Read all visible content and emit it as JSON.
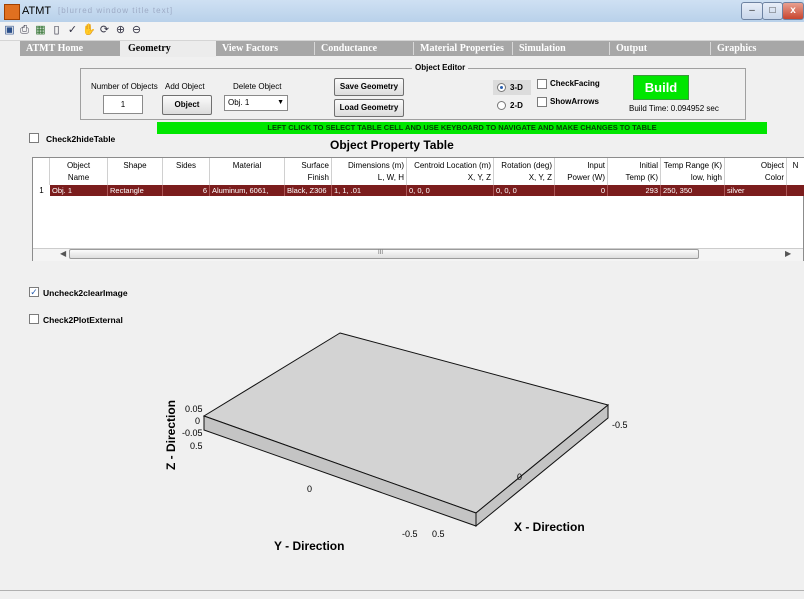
{
  "window": {
    "title": "ATMT",
    "title_extra": "[blurred window title text]"
  },
  "toolbar": {
    "icons": [
      "save-icon",
      "print-icon",
      "table-icon",
      "page-icon",
      "data-cursor-icon",
      "pan-icon",
      "rotate-icon",
      "zoom-in-icon",
      "zoom-out-icon"
    ]
  },
  "tabs": [
    "ATMT Home",
    "Geometry",
    "View Factors",
    "Conductance",
    "Material Properties",
    "Simulation",
    "Output",
    "Graphics"
  ],
  "active_tab": "Geometry",
  "editor": {
    "legend": "Object Editor",
    "num_objects_label": "Number of Objects",
    "num_objects_value": "1",
    "add_object_label": "Add Object",
    "add_object_button": "Object",
    "delete_object_label": "Delete Object",
    "delete_object_value": "Obj. 1",
    "save_geometry": "Save Geometry",
    "load_geometry": "Load Geometry",
    "mode_3d": "3-D",
    "mode_2d": "2-D",
    "check_facing": "CheckFacing",
    "show_arrows": "ShowArrows",
    "build_button": "Build",
    "build_time": "Build Time: 0.094952 sec"
  },
  "instruction": "LEFT CLICK TO SELECT TABLE CELL AND USE KEYBOARD TO NAVIGATE AND MAKE CHANGES TO TABLE",
  "check_hide_table": "Check2hideTable",
  "table": {
    "title": "Object Property Table",
    "headers": [
      {
        "l1": "Object",
        "l2": "Name"
      },
      {
        "l1": "Shape",
        "l2": ""
      },
      {
        "l1": "Sides",
        "l2": ""
      },
      {
        "l1": "Material",
        "l2": ""
      },
      {
        "l1": "Surface",
        "l2": "Finish"
      },
      {
        "l1": "Dimensions (m)",
        "l2": "L, W, H"
      },
      {
        "l1": "Centroid Location (m)",
        "l2": "X, Y, Z"
      },
      {
        "l1": "Rotation (deg)",
        "l2": "X, Y, Z"
      },
      {
        "l1": "Input",
        "l2": "Power (W)"
      },
      {
        "l1": "Initial",
        "l2": "Temp (K)"
      },
      {
        "l1": "Temp Range (K)",
        "l2": "low, high"
      },
      {
        "l1": "Object",
        "l2": "Color"
      },
      {
        "l1": "N",
        "l2": ""
      }
    ],
    "rows": [
      {
        "no": "1",
        "cells": [
          "Obj. 1",
          "Rectangle",
          "6",
          "Aluminum, 6061,",
          "Black, Z306",
          "1, 1, .01",
          "0, 0, 0",
          "0, 0, 0",
          "0",
          "293",
          "250, 350",
          "silver",
          ""
        ]
      }
    ],
    "scroll_marker": "III"
  },
  "uncheck_clear": "Uncheck2clearImage",
  "check_external": "Check2PlotExternal",
  "plot": {
    "z_title": "Z - Direction",
    "y_title": "Y - Direction",
    "x_title": "X - Direction",
    "z_ticks": [
      "0.05",
      "0",
      "-0.05",
      "0.5"
    ],
    "x_ticks": [
      "-0.5",
      "0",
      "0.5"
    ],
    "y_ticks": [
      "0",
      "-0.5"
    ],
    "x_right_tick": "-0.5",
    "box_top_color": "#d3d3d3",
    "box_side_color": "#c4c4c4"
  }
}
